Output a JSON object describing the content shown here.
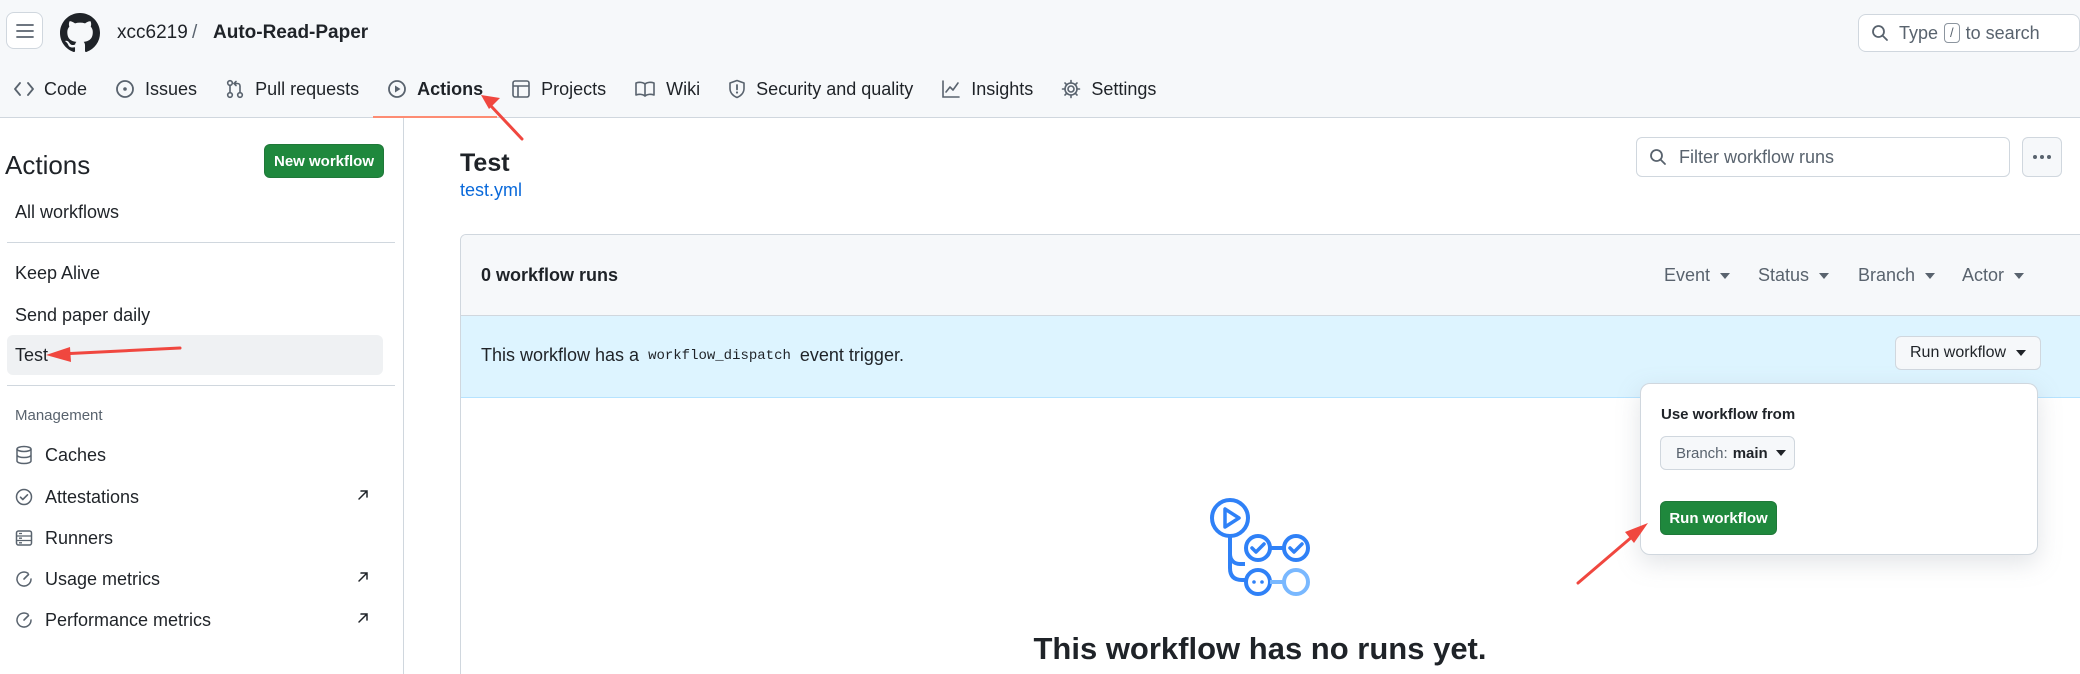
{
  "header": {
    "owner": "xcc6219",
    "separator": "/",
    "repo": "Auto-Read-Paper",
    "search": {
      "prefix": "Type",
      "key": "/",
      "suffix": "to search"
    }
  },
  "tabs": [
    {
      "label": "Code",
      "icon": "code-icon"
    },
    {
      "label": "Issues",
      "icon": "issue-opened-icon"
    },
    {
      "label": "Pull requests",
      "icon": "git-pull-request-icon"
    },
    {
      "label": "Actions",
      "icon": "play-icon",
      "active": true
    },
    {
      "label": "Projects",
      "icon": "table-icon"
    },
    {
      "label": "Wiki",
      "icon": "book-icon"
    },
    {
      "label": "Security and quality",
      "icon": "shield-icon"
    },
    {
      "label": "Insights",
      "icon": "graph-icon"
    },
    {
      "label": "Settings",
      "icon": "gear-icon"
    }
  ],
  "sidebar": {
    "title": "Actions",
    "new_workflow": "New workflow",
    "all_workflows": "All workflows",
    "workflows": [
      "Keep Alive",
      "Send paper daily",
      "Test"
    ],
    "selected": "Test",
    "management_heading": "Management",
    "management": [
      {
        "label": "Caches",
        "icon": "database-icon",
        "external": false
      },
      {
        "label": "Attestations",
        "icon": "verified-icon",
        "external": true
      },
      {
        "label": "Runners",
        "icon": "server-icon",
        "external": false
      },
      {
        "label": "Usage metrics",
        "icon": "meter-icon",
        "external": true
      },
      {
        "label": "Performance metrics",
        "icon": "meter-icon",
        "external": true
      }
    ]
  },
  "main": {
    "title": "Test",
    "file_link": "test.yml",
    "filter_placeholder": "Filter workflow runs",
    "runs_count": "0 workflow runs",
    "filters": [
      "Event",
      "Status",
      "Branch",
      "Actor"
    ],
    "info_prefix": "This workflow has a",
    "info_code": "workflow_dispatch",
    "info_suffix": "event trigger.",
    "run_workflow_dropdown": "Run workflow",
    "empty_title": "This workflow has no runs yet."
  },
  "popover": {
    "label": "Use workflow from",
    "branch_prefix": "Branch:",
    "branch_value": "main",
    "run_button": "Run workflow"
  },
  "colors": {
    "accent_green": "#1f883d",
    "link_blue": "#0969da",
    "info_bg": "#ddf4ff",
    "tab_underline": "#fd8c73",
    "annotation_red": "#f0473f"
  }
}
